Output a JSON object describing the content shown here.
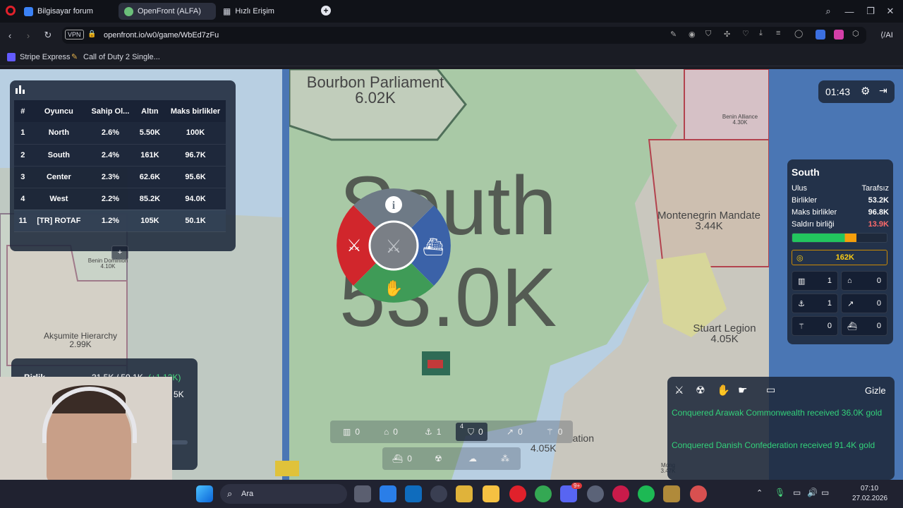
{
  "browser": {
    "tabs": [
      {
        "label": "Bilgisayar forum",
        "active": false
      },
      {
        "label": "OpenFront (ALFA)",
        "active": true
      },
      {
        "label": "Hızlı Erişim",
        "active": false
      }
    ],
    "vpn_label": "VPN",
    "url": "openfront.io/w0/game/WbEd7zFu",
    "ai_label": "AI",
    "bookmarks": [
      {
        "label": "Stripe Express"
      },
      {
        "label": "Call of Duty 2 Single..."
      }
    ]
  },
  "game": {
    "timer": "01:43",
    "leaderboard": {
      "headers": [
        "#",
        "Oyuncu",
        "Sahip Ol...",
        "Altın",
        "Maks birlikler"
      ],
      "rows": [
        {
          "rank": "1",
          "player": "North",
          "owned": "2.6%",
          "gold": "5.50K",
          "max_troops": "100K"
        },
        {
          "rank": "2",
          "player": "South",
          "owned": "2.4%",
          "gold": "161K",
          "max_troops": "96.7K"
        },
        {
          "rank": "3",
          "player": "Center",
          "owned": "2.3%",
          "gold": "62.6K",
          "max_troops": "95.6K"
        },
        {
          "rank": "4",
          "player": "West",
          "owned": "2.2%",
          "gold": "85.2K",
          "max_troops": "94.0K"
        },
        {
          "rank": "11",
          "player": "[TR] ROTAF",
          "owned": "1.2%",
          "gold": "105K",
          "max_troops": "50.1K"
        }
      ],
      "expand_label": "+"
    },
    "map_labels": {
      "bourbon_name": "Bourbon Parliament",
      "bourbon_value": "6.02K",
      "south_name": "South",
      "south_value": "53.0K",
      "benin_alliance_name": "Benin Alliance",
      "benin_alliance_value": "4.30K",
      "montenegrin_name": "Montenegrin Mandate",
      "montenegrin_value": "3.44K",
      "benin_dominion_name": "Benin Dominion",
      "benin_dominion_value": "4.10K",
      "aksumite_name": "Akşumite Hierarchy",
      "aksumite_value": "2.99K",
      "stuart_name": "Stuart Legion",
      "stuart_value": "4.05K",
      "bottom_value": "4.05K",
      "bottom_name_fragment": "ation",
      "mong_fragment": "Mong",
      "mong_value": "3.47K"
    },
    "troops_panel": {
      "label": "Birlik",
      "value": "31.5K / 50.1K",
      "rate": "(+1.12K)",
      "gold_fragment": "5K"
    },
    "player_panel": {
      "name": "South",
      "rows": [
        {
          "label": "Ulus",
          "value": "Tarafsız",
          "color": "#ffffff"
        },
        {
          "label": "Birlikler",
          "value": "53.2K",
          "color": "#ffffff"
        },
        {
          "label": "Maks birlikler",
          "value": "96.8K",
          "color": "#ffffff"
        },
        {
          "label": "Saldırı birliği",
          "value": "13.9K",
          "color": "#ff6b6b"
        }
      ],
      "troop_bar_fraction": 0.68,
      "gold": "162K",
      "buildings": [
        {
          "icon": "city-icon",
          "value": "1"
        },
        {
          "icon": "factory-icon",
          "value": "0"
        },
        {
          "icon": "port-icon",
          "value": "1"
        },
        {
          "icon": "missile-silo-icon",
          "value": "0"
        },
        {
          "icon": "sam-launcher-icon",
          "value": "0"
        },
        {
          "icon": "warship-icon",
          "value": "0"
        }
      ]
    },
    "radial_menu": {
      "info_glyph": "i"
    },
    "events": {
      "hide_label": "Gizle",
      "messages": [
        "Conquered Arawak Commonwealth received 36.0K gold",
        "Conquered Danish Confederation received 91.4K gold"
      ]
    },
    "bottom_bar": {
      "row1": [
        {
          "icon": "city-icon",
          "value": "0"
        },
        {
          "icon": "factory-icon",
          "value": "0"
        },
        {
          "icon": "port-icon",
          "value": "1"
        },
        {
          "icon": "defense-post-icon",
          "value": "0",
          "hotkey": "4"
        },
        {
          "icon": "missile-silo-icon",
          "value": "0"
        },
        {
          "icon": "sam-launcher-icon",
          "value": "0"
        }
      ],
      "row2": [
        {
          "icon": "warship-icon",
          "value": "0"
        },
        {
          "icon": "atom-bomb-icon",
          "value": ""
        },
        {
          "icon": "hydrogen-bomb-icon",
          "value": ""
        },
        {
          "icon": "mirv-icon",
          "value": ""
        }
      ]
    }
  },
  "taskbar": {
    "search_label": "Ara",
    "time": "07:10",
    "date": "27.02.2026",
    "discord_badge": "9+"
  }
}
